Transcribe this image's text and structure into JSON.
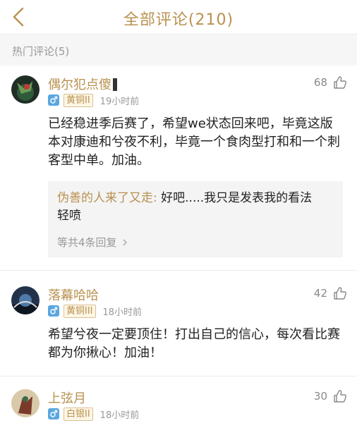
{
  "header": {
    "title": "全部评论(210)"
  },
  "section": {
    "title": "热门评论(5)"
  },
  "colors": {
    "accent": "#b99150",
    "muted": "#999999",
    "gender_male": "#5aa7e0"
  },
  "comments": [
    {
      "username": "偶尔犯点傻",
      "gender": "♂",
      "rank": "黄铜II",
      "time": "19小时前",
      "likes": "68",
      "text": "已经稳进季后赛了，希望we状态回来吧，毕竟这版本对康迪和兮夜不利，毕竟一个食肉型打和和一个刺客型中单。加油。",
      "reply": {
        "author": "伪善的人来了又走:",
        "text": "好吧.....我只是发表我的看法　轻喷",
        "more": "等共4条回复"
      }
    },
    {
      "username": "落幕哈哈",
      "gender": "♂",
      "rank": "黄铜III",
      "time": "18小时前",
      "likes": "42",
      "text": "希望兮夜一定要顶住！打出自己的信心，每次看比赛都为你揪心！加油！"
    },
    {
      "username": "上弦月",
      "gender": "♂",
      "rank": "白银II",
      "time": "18小时前",
      "likes": "30"
    }
  ]
}
